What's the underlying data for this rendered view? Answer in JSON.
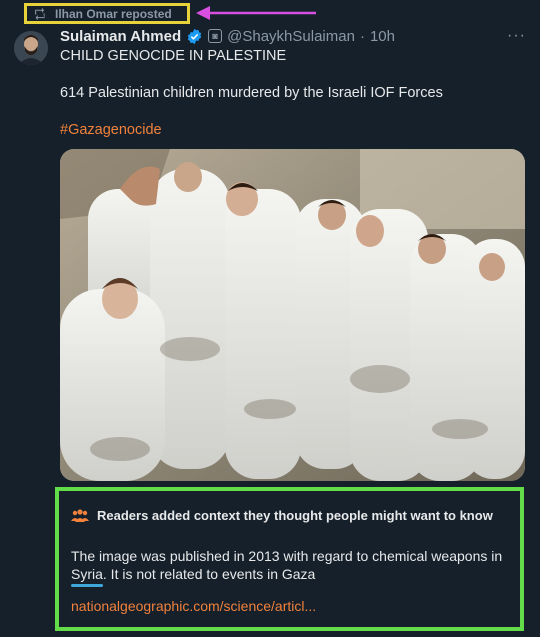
{
  "repost": {
    "label": "Ilhan Omar reposted"
  },
  "author": {
    "name": "Sulaiman Ahmed",
    "handle": "@ShaykhSulaiman",
    "separator": "·",
    "time": "10h",
    "more": "···"
  },
  "post": {
    "line1": "CHILD GENOCIDE IN PALESTINE",
    "line2": "614 Palestinian children murdered by the Israeli IOF Forces",
    "hashtag": "#Gazagenocide"
  },
  "context": {
    "heading": "Readers added context they thought people might want to know",
    "body": "The image was published in 2013 with regard to chemical weapons in Syria. It is not related to events in Gaza",
    "link": "nationalgeographic.com/science/articl..."
  },
  "colors": {
    "background": "#15202b",
    "accent_link": "#f1813b",
    "highlight_yellow": "#e8d23a",
    "highlight_green": "#62dc48",
    "arrow_magenta": "#d94fe0",
    "verified_blue": "#1d9bf0"
  },
  "icons": [
    "repost-icon",
    "arrow-icon",
    "verified-badge-icon",
    "affiliate-badge-icon",
    "more-icon",
    "people-icon"
  ]
}
